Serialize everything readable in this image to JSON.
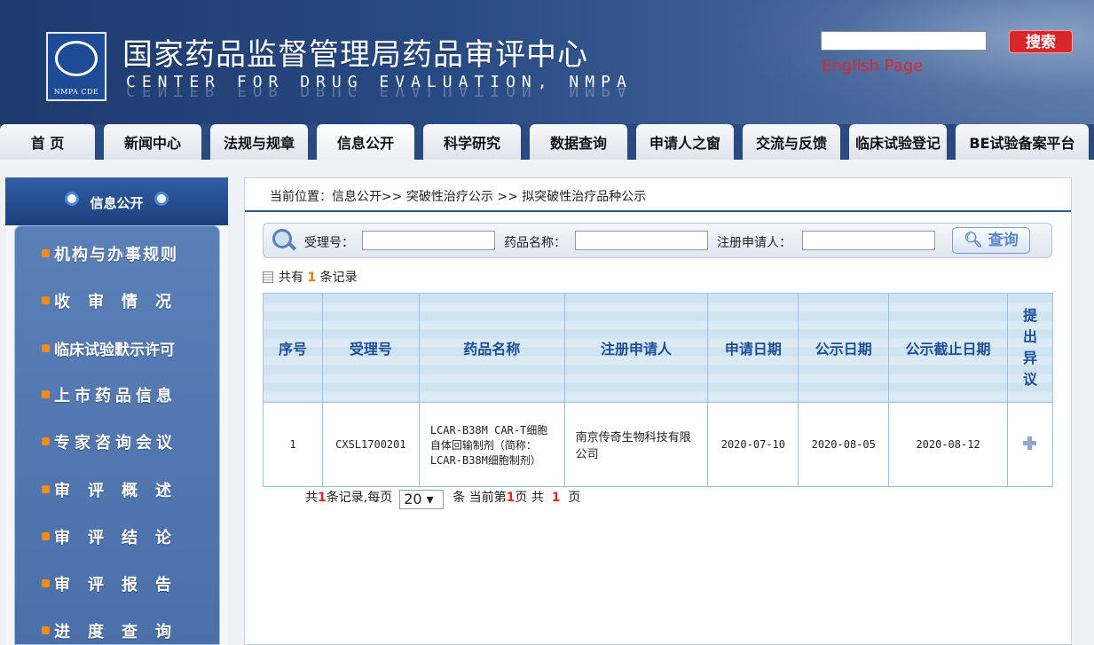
{
  "header": {
    "title": "国家药品监督管理局药品审评中心",
    "subtitle": "CENTER FOR DRUG EVALUATION, NMPA",
    "logo_caption": "NMPA CDE",
    "search_button": "搜索",
    "english_link": "English Page"
  },
  "nav": [
    {
      "label": "首 页"
    },
    {
      "label": "新闻中心"
    },
    {
      "label": "法规与规章"
    },
    {
      "label": "信息公开"
    },
    {
      "label": "科学研究"
    },
    {
      "label": "数据查询"
    },
    {
      "label": "申请人之窗"
    },
    {
      "label": "交流与反馈"
    },
    {
      "label": "临床试验登记"
    },
    {
      "label": "BE试验备案平台"
    }
  ],
  "sidebar": {
    "title": "信息公开",
    "items": [
      {
        "label": "机构与办事规则"
      },
      {
        "label": "收审情况"
      },
      {
        "label": "临床试验默示许可"
      },
      {
        "label": "上市药品信息"
      },
      {
        "label": "专家咨询会议"
      },
      {
        "label": "审评概述"
      },
      {
        "label": "审评结论"
      },
      {
        "label": "审评报告"
      },
      {
        "label": "进度查询"
      }
    ]
  },
  "breadcrumb": "当前位置：信息公开>> 突破性治疗公示 >> 拟突破性治疗品种公示",
  "filter": {
    "acceptance_label": "受理号：",
    "drug_label": "药品名称：",
    "applicant_label": "注册申请人：",
    "query_button": "查询"
  },
  "record_count": {
    "prefix": "共有",
    "count": "1",
    "suffix": "条记录"
  },
  "table": {
    "headers": [
      "序号",
      "受理号",
      "药品名称",
      "注册申请人",
      "申请日期",
      "公示日期",
      "公示截止日期",
      "提出异议"
    ],
    "rows": [
      {
        "no": "1",
        "acceptance_no": "CXSL1700201",
        "drug_name": "LCAR-B38M CAR-T细胞自体回输制剂（简称：LCAR-B38M细胞制剂）",
        "applicant": "南京传奇生物科技有限公司",
        "apply_date": "2020-07-10",
        "publish_date": "2020-08-05",
        "deadline": "2020-08-12"
      }
    ]
  },
  "pager": {
    "t1": "共",
    "total": "1",
    "t2": "条记录,每页",
    "page_size": "20 ▾",
    "t3": "条 当前第",
    "current": "1",
    "t4": "页 共",
    "pages": "1",
    "t5": "页"
  },
  "colors": {
    "nav_bg": "#2a4a7f",
    "header_text": "#1c4e96",
    "accent_red": "#e0262a",
    "count_orange": "#e8790a"
  }
}
